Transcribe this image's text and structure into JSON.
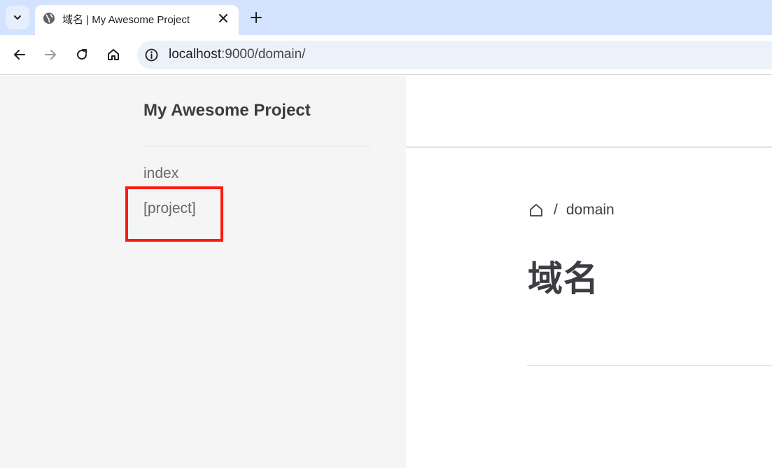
{
  "browser": {
    "tab": {
      "title": "域名 | My Awesome Project",
      "favicon": "globe-icon"
    },
    "address_bar": {
      "host": "localhost",
      "path": ":9000/domain/"
    },
    "icons": {
      "tab_search": "chevron-down-icon",
      "close": "close-icon",
      "new_tab": "plus-icon",
      "back": "arrow-left-icon",
      "forward": "arrow-right-icon",
      "reload": "reload-icon",
      "home": "home-icon",
      "site_info": "info-icon"
    }
  },
  "sidebar": {
    "title": "My Awesome Project",
    "items": [
      {
        "label": "index"
      },
      {
        "label": "[project]"
      }
    ],
    "highlight_color": "#ff1a0f"
  },
  "main": {
    "breadcrumb": {
      "home_icon": "home-outline-icon",
      "separator": "/",
      "current": "domain"
    },
    "page_title": "域名"
  }
}
